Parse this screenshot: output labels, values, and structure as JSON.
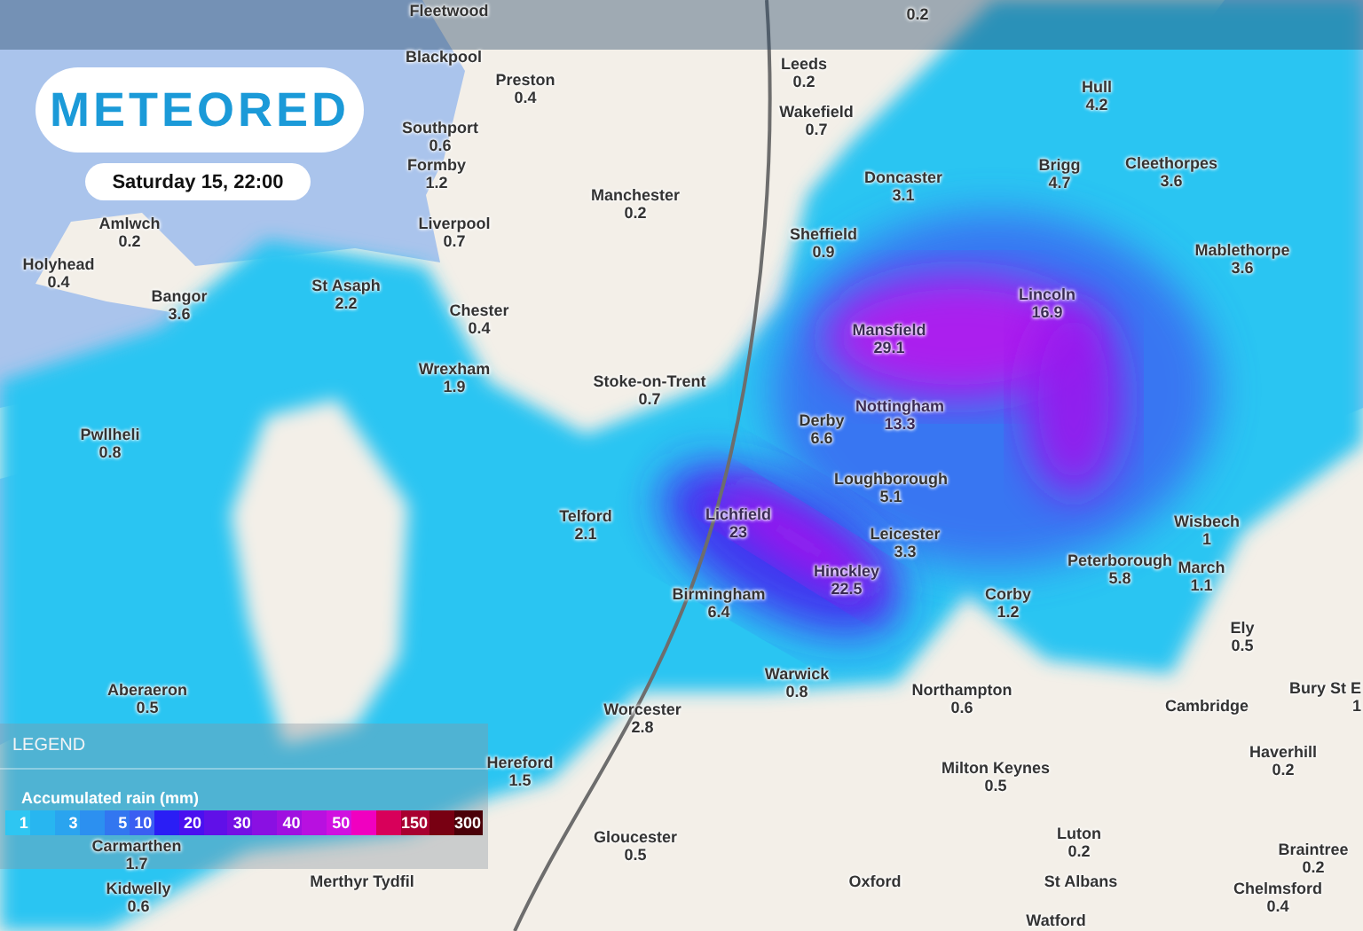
{
  "brand": {
    "logo": "METEORED"
  },
  "timestamp": "Saturday 15, 22:00",
  "places": [
    {
      "name": "Fleetwood"
    },
    {
      "value": "0.2"
    },
    {
      "name": "Blackpool"
    },
    {
      "name": "Preston",
      "value": "0.4"
    },
    {
      "name": "Leeds",
      "value": "0.2"
    },
    {
      "name": "Hull",
      "value": "4.2"
    },
    {
      "name": "Wakefield",
      "value": "0.7"
    },
    {
      "name": "Southport",
      "value": "0.6"
    },
    {
      "name": "Formby",
      "value": "1.2"
    },
    {
      "name": "Brigg",
      "value": "4.7"
    },
    {
      "name": "Cleethorpes",
      "value": "3.6"
    },
    {
      "name": "Doncaster",
      "value": "3.1"
    },
    {
      "name": "Manchester",
      "value": "0.2"
    },
    {
      "name": "Amlwch",
      "value": "0.2"
    },
    {
      "name": "Liverpool",
      "value": "0.7"
    },
    {
      "name": "Sheffield",
      "value": "0.9"
    },
    {
      "name": "Mablethorpe",
      "value": "3.6"
    },
    {
      "name": "Holyhead",
      "value": "0.4"
    },
    {
      "name": "St Asaph",
      "value": "2.2"
    },
    {
      "name": "Bangor",
      "value": "3.6"
    },
    {
      "name": "Chester",
      "value": "0.4"
    },
    {
      "name": "Lincoln",
      "value": "16.9"
    },
    {
      "name": "Mansfield",
      "value": "29.1"
    },
    {
      "name": "Wrexham",
      "value": "1.9"
    },
    {
      "name": "Stoke-on-Trent",
      "value": "0.7"
    },
    {
      "name": "Nottingham",
      "value": "13.3"
    },
    {
      "name": "Derby",
      "value": "6.6"
    },
    {
      "name": "Pwllheli",
      "value": "0.8"
    },
    {
      "name": "Loughborough",
      "value": "5.1"
    },
    {
      "name": "Telford",
      "value": "2.1"
    },
    {
      "name": "Lichfield",
      "value": "23"
    },
    {
      "name": "Wisbech",
      "value": "1"
    },
    {
      "name": "Leicester",
      "value": "3.3"
    },
    {
      "name": "Hinckley",
      "value": "22.5"
    },
    {
      "name": "Peterborough",
      "value": "5.8"
    },
    {
      "name": "March",
      "value": "1.1"
    },
    {
      "name": "Birmingham",
      "value": "6.4"
    },
    {
      "name": "Corby",
      "value": "1.2"
    },
    {
      "name": "Ely",
      "value": "0.5"
    },
    {
      "name": "Warwick",
      "value": "0.8"
    },
    {
      "name": "Aberaeron",
      "value": "0.5"
    },
    {
      "name": "Northampton",
      "value": "0.6"
    },
    {
      "name": "Cambridge"
    },
    {
      "name": "Bury St E",
      "value": "1"
    },
    {
      "name": "Worcester",
      "value": "2.8"
    },
    {
      "name": "Hereford",
      "value": "1.5"
    },
    {
      "name": "Haverhill",
      "value": "0.2"
    },
    {
      "name": "Milton Keynes",
      "value": "0.5"
    },
    {
      "name": "Carmarthen",
      "value": "1.7"
    },
    {
      "name": "Gloucester",
      "value": "0.5"
    },
    {
      "name": "Luton",
      "value": "0.2"
    },
    {
      "name": "Braintree",
      "value": "0.2"
    },
    {
      "name": "Merthyr Tydfil"
    },
    {
      "name": "Oxford"
    },
    {
      "name": "St Albans"
    },
    {
      "name": "Kidwelly",
      "value": "0.6"
    },
    {
      "name": "Chelmsford",
      "value": "0.4"
    },
    {
      "name": "Watford"
    }
  ],
  "legend": {
    "header": "LEGEND",
    "title": "Accumulated rain (mm)",
    "scale": [
      {
        "label": "1",
        "color": "#2ec6f2"
      },
      {
        "color": "#28b6f0"
      },
      {
        "label": "3",
        "color": "#2aa4ef"
      },
      {
        "color": "#2c90f0"
      },
      {
        "label": "5",
        "color": "#3276f0"
      },
      {
        "label": "10",
        "color": "#3a5ef2"
      },
      {
        "color": "#2a1ef5"
      },
      {
        "label": "20",
        "color": "#4a10f0"
      },
      {
        "color": "#6010e8"
      },
      {
        "label": "30",
        "color": "#7410e4"
      },
      {
        "color": "#8a10e2"
      },
      {
        "label": "40",
        "color": "#a010e0"
      },
      {
        "color": "#b810e0"
      },
      {
        "label": "50",
        "color": "#d010e0"
      },
      {
        "color": "#f000c0"
      },
      {
        "color": "#d8005a"
      },
      {
        "label": "150",
        "color": "#a80030"
      },
      {
        "color": "#780012"
      },
      {
        "label": "300",
        "color": "#4a0008"
      }
    ]
  }
}
